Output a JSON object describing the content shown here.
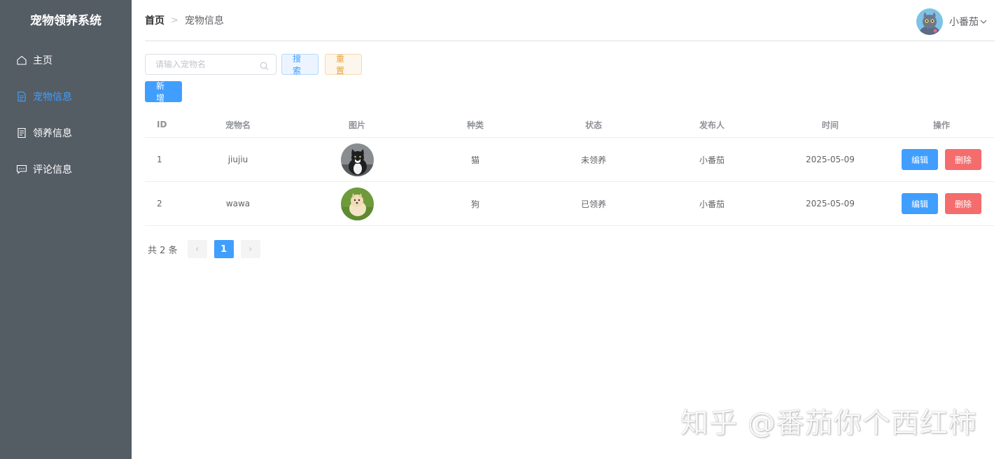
{
  "app": {
    "title": "宠物领养系统"
  },
  "sidebar": {
    "items": [
      {
        "label": "主页",
        "icon": "home-icon",
        "active": false
      },
      {
        "label": "宠物信息",
        "icon": "document-icon",
        "active": true
      },
      {
        "label": "领养信息",
        "icon": "document-icon",
        "active": false
      },
      {
        "label": "评论信息",
        "icon": "chat-icon",
        "active": false
      }
    ]
  },
  "header": {
    "breadcrumb": {
      "home": "首页",
      "separator": ">",
      "current": "宠物信息"
    },
    "user": {
      "name": "小番茄"
    }
  },
  "toolbar": {
    "search_placeholder": "请输入宠物名",
    "search_value": "",
    "search_label": "搜索",
    "reset_label": "重置",
    "add_label": "新增"
  },
  "table": {
    "columns": [
      "ID",
      "宠物名",
      "图片",
      "种类",
      "状态",
      "发布人",
      "时间",
      "操作"
    ],
    "rows": [
      {
        "id": "1",
        "name": "jiujiu",
        "image": "cat",
        "kind": "猫",
        "status": "未领养",
        "publisher": "小番茄",
        "time": "2025-05-09",
        "edit": "编辑",
        "delete": "删除"
      },
      {
        "id": "2",
        "name": "wawa",
        "image": "dog",
        "kind": "狗",
        "status": "已领养",
        "publisher": "小番茄",
        "time": "2025-05-09",
        "edit": "编辑",
        "delete": "删除"
      }
    ]
  },
  "pagination": {
    "total_text": "共 2 条",
    "prev": "‹",
    "current": "1",
    "next": "›"
  },
  "watermark": "知乎 @番茄你个西红柿",
  "colors": {
    "sidebar_bg": "#545c64",
    "accent": "#409eff",
    "danger": "#f56c6c",
    "warning": "#e6a23c"
  }
}
